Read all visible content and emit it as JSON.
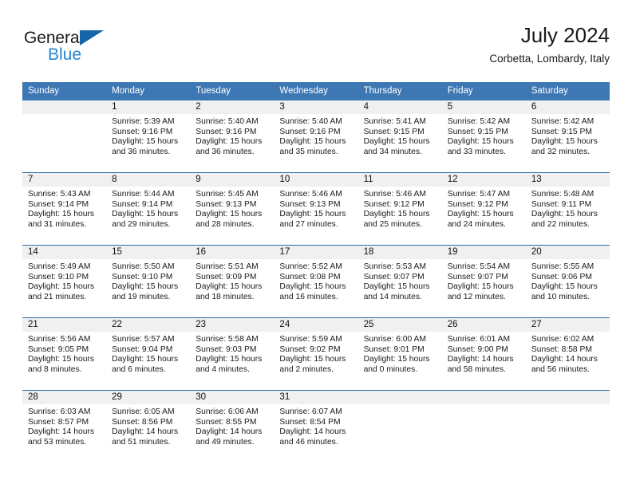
{
  "brand": {
    "name_part1": "General",
    "name_part2": "Blue",
    "triangle_color": "#1565a8",
    "blue_color": "#2585d3"
  },
  "header": {
    "title": "July 2024",
    "location": "Corbetta, Lombardy, Italy"
  },
  "theme": {
    "header_blue": "#3d77b4",
    "row_divider": "#2e6da4",
    "day_band": "#f0f0f0"
  },
  "weekdays": [
    "Sunday",
    "Monday",
    "Tuesday",
    "Wednesday",
    "Thursday",
    "Friday",
    "Saturday"
  ],
  "weeks": [
    [
      {
        "day": "",
        "lines": []
      },
      {
        "day": "1",
        "lines": [
          "Sunrise: 5:39 AM",
          "Sunset: 9:16 PM",
          "Daylight: 15 hours",
          "and 36 minutes."
        ]
      },
      {
        "day": "2",
        "lines": [
          "Sunrise: 5:40 AM",
          "Sunset: 9:16 PM",
          "Daylight: 15 hours",
          "and 36 minutes."
        ]
      },
      {
        "day": "3",
        "lines": [
          "Sunrise: 5:40 AM",
          "Sunset: 9:16 PM",
          "Daylight: 15 hours",
          "and 35 minutes."
        ]
      },
      {
        "day": "4",
        "lines": [
          "Sunrise: 5:41 AM",
          "Sunset: 9:15 PM",
          "Daylight: 15 hours",
          "and 34 minutes."
        ]
      },
      {
        "day": "5",
        "lines": [
          "Sunrise: 5:42 AM",
          "Sunset: 9:15 PM",
          "Daylight: 15 hours",
          "and 33 minutes."
        ]
      },
      {
        "day": "6",
        "lines": [
          "Sunrise: 5:42 AM",
          "Sunset: 9:15 PM",
          "Daylight: 15 hours",
          "and 32 minutes."
        ]
      }
    ],
    [
      {
        "day": "7",
        "lines": [
          "Sunrise: 5:43 AM",
          "Sunset: 9:14 PM",
          "Daylight: 15 hours",
          "and 31 minutes."
        ]
      },
      {
        "day": "8",
        "lines": [
          "Sunrise: 5:44 AM",
          "Sunset: 9:14 PM",
          "Daylight: 15 hours",
          "and 29 minutes."
        ]
      },
      {
        "day": "9",
        "lines": [
          "Sunrise: 5:45 AM",
          "Sunset: 9:13 PM",
          "Daylight: 15 hours",
          "and 28 minutes."
        ]
      },
      {
        "day": "10",
        "lines": [
          "Sunrise: 5:46 AM",
          "Sunset: 9:13 PM",
          "Daylight: 15 hours",
          "and 27 minutes."
        ]
      },
      {
        "day": "11",
        "lines": [
          "Sunrise: 5:46 AM",
          "Sunset: 9:12 PM",
          "Daylight: 15 hours",
          "and 25 minutes."
        ]
      },
      {
        "day": "12",
        "lines": [
          "Sunrise: 5:47 AM",
          "Sunset: 9:12 PM",
          "Daylight: 15 hours",
          "and 24 minutes."
        ]
      },
      {
        "day": "13",
        "lines": [
          "Sunrise: 5:48 AM",
          "Sunset: 9:11 PM",
          "Daylight: 15 hours",
          "and 22 minutes."
        ]
      }
    ],
    [
      {
        "day": "14",
        "lines": [
          "Sunrise: 5:49 AM",
          "Sunset: 9:10 PM",
          "Daylight: 15 hours",
          "and 21 minutes."
        ]
      },
      {
        "day": "15",
        "lines": [
          "Sunrise: 5:50 AM",
          "Sunset: 9:10 PM",
          "Daylight: 15 hours",
          "and 19 minutes."
        ]
      },
      {
        "day": "16",
        "lines": [
          "Sunrise: 5:51 AM",
          "Sunset: 9:09 PM",
          "Daylight: 15 hours",
          "and 18 minutes."
        ]
      },
      {
        "day": "17",
        "lines": [
          "Sunrise: 5:52 AM",
          "Sunset: 9:08 PM",
          "Daylight: 15 hours",
          "and 16 minutes."
        ]
      },
      {
        "day": "18",
        "lines": [
          "Sunrise: 5:53 AM",
          "Sunset: 9:07 PM",
          "Daylight: 15 hours",
          "and 14 minutes."
        ]
      },
      {
        "day": "19",
        "lines": [
          "Sunrise: 5:54 AM",
          "Sunset: 9:07 PM",
          "Daylight: 15 hours",
          "and 12 minutes."
        ]
      },
      {
        "day": "20",
        "lines": [
          "Sunrise: 5:55 AM",
          "Sunset: 9:06 PM",
          "Daylight: 15 hours",
          "and 10 minutes."
        ]
      }
    ],
    [
      {
        "day": "21",
        "lines": [
          "Sunrise: 5:56 AM",
          "Sunset: 9:05 PM",
          "Daylight: 15 hours",
          "and 8 minutes."
        ]
      },
      {
        "day": "22",
        "lines": [
          "Sunrise: 5:57 AM",
          "Sunset: 9:04 PM",
          "Daylight: 15 hours",
          "and 6 minutes."
        ]
      },
      {
        "day": "23",
        "lines": [
          "Sunrise: 5:58 AM",
          "Sunset: 9:03 PM",
          "Daylight: 15 hours",
          "and 4 minutes."
        ]
      },
      {
        "day": "24",
        "lines": [
          "Sunrise: 5:59 AM",
          "Sunset: 9:02 PM",
          "Daylight: 15 hours",
          "and 2 minutes."
        ]
      },
      {
        "day": "25",
        "lines": [
          "Sunrise: 6:00 AM",
          "Sunset: 9:01 PM",
          "Daylight: 15 hours",
          "and 0 minutes."
        ]
      },
      {
        "day": "26",
        "lines": [
          "Sunrise: 6:01 AM",
          "Sunset: 9:00 PM",
          "Daylight: 14 hours",
          "and 58 minutes."
        ]
      },
      {
        "day": "27",
        "lines": [
          "Sunrise: 6:02 AM",
          "Sunset: 8:58 PM",
          "Daylight: 14 hours",
          "and 56 minutes."
        ]
      }
    ],
    [
      {
        "day": "28",
        "lines": [
          "Sunrise: 6:03 AM",
          "Sunset: 8:57 PM",
          "Daylight: 14 hours",
          "and 53 minutes."
        ]
      },
      {
        "day": "29",
        "lines": [
          "Sunrise: 6:05 AM",
          "Sunset: 8:56 PM",
          "Daylight: 14 hours",
          "and 51 minutes."
        ]
      },
      {
        "day": "30",
        "lines": [
          "Sunrise: 6:06 AM",
          "Sunset: 8:55 PM",
          "Daylight: 14 hours",
          "and 49 minutes."
        ]
      },
      {
        "day": "31",
        "lines": [
          "Sunrise: 6:07 AM",
          "Sunset: 8:54 PM",
          "Daylight: 14 hours",
          "and 46 minutes."
        ]
      },
      {
        "day": "",
        "lines": []
      },
      {
        "day": "",
        "lines": []
      },
      {
        "day": "",
        "lines": []
      }
    ]
  ]
}
